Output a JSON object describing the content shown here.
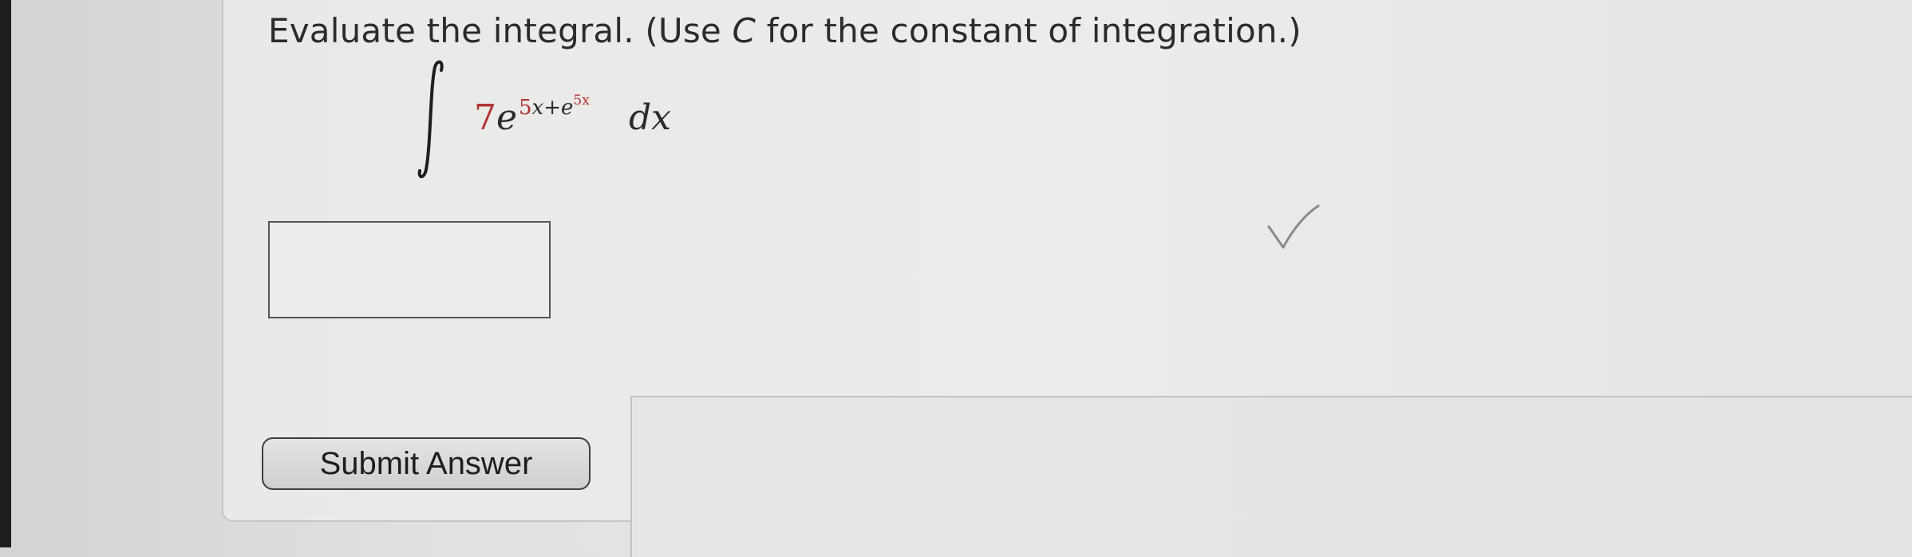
{
  "question": {
    "prompt_before": "Evaluate the integral. (Use ",
    "prompt_var": "C",
    "prompt_after": " for the constant of integration.)"
  },
  "integral": {
    "coefficient": "7",
    "base": "e",
    "exponent_part1": "5",
    "exponent_var1": "x",
    "exponent_plus": "+",
    "exponent_inner_base": "e",
    "exponent_inner_exp": "5x",
    "differential": "dx"
  },
  "answer": {
    "value": ""
  },
  "submit": {
    "label": "Submit Answer"
  },
  "colors": {
    "accent_red": "#b23434",
    "text": "#2b2b2b"
  }
}
